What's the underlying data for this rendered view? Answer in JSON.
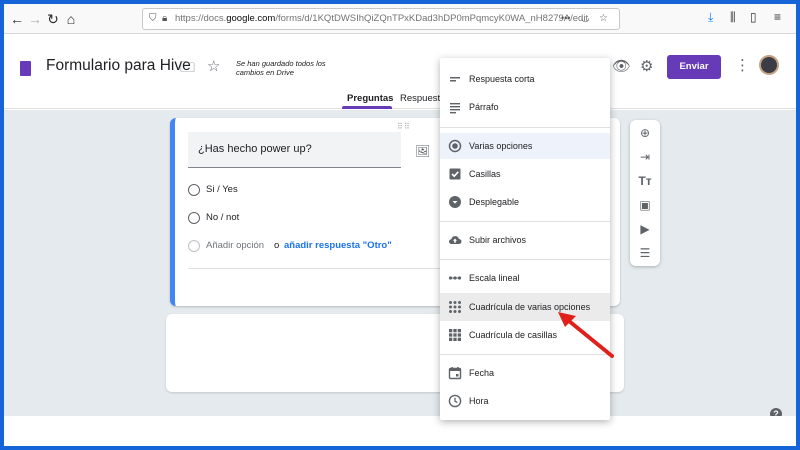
{
  "browser": {
    "url_prefix": "https://docs.",
    "url_domain": "google.com",
    "url_path": "/forms/d/1KQtDWSIhQiZQnTPxKDad3hDP0mPqmcyK0WA_nH8279A/edit",
    "more_label": "•••"
  },
  "header": {
    "title": "Formulario para Hive",
    "saved_status": "Se han guardado todos los cambios en Drive",
    "send_label": "Enviar"
  },
  "tabs": [
    {
      "label": "Preguntas",
      "active": true
    },
    {
      "label": "Respuesta",
      "active": false
    }
  ],
  "question": {
    "title": "¿Has hecho power up?",
    "options": [
      "Si / Yes",
      "No / not"
    ],
    "add_option_label": "Añadir opción",
    "or_label": "o",
    "add_other_label": "añadir respuesta \"Otro\""
  },
  "menu": {
    "items": [
      {
        "label": "Respuesta corta",
        "icon": "short-answer-icon"
      },
      {
        "label": "Párrafo",
        "icon": "paragraph-icon"
      },
      {
        "label": "Varias opciones",
        "icon": "radio-button-icon",
        "selected": true
      },
      {
        "label": "Casillas",
        "icon": "checkbox-icon"
      },
      {
        "label": "Desplegable",
        "icon": "dropdown-circle-icon"
      },
      {
        "label": "Subir archivos",
        "icon": "cloud-upload-icon"
      },
      {
        "label": "Escala lineal",
        "icon": "linear-scale-icon"
      },
      {
        "label": "Cuadrícula de varias opciones",
        "icon": "grid-dots-icon",
        "hover": true
      },
      {
        "label": "Cuadrícula de casillas",
        "icon": "grid-squares-icon"
      },
      {
        "label": "Fecha",
        "icon": "calendar-icon"
      },
      {
        "label": "Hora",
        "icon": "clock-icon"
      }
    ]
  },
  "colors": {
    "accent": "#673ab7",
    "question_border": "#4285f4",
    "link": "#1a73e8",
    "annotation_arrow": "#e0201b",
    "frame_border": "#1565d8"
  }
}
